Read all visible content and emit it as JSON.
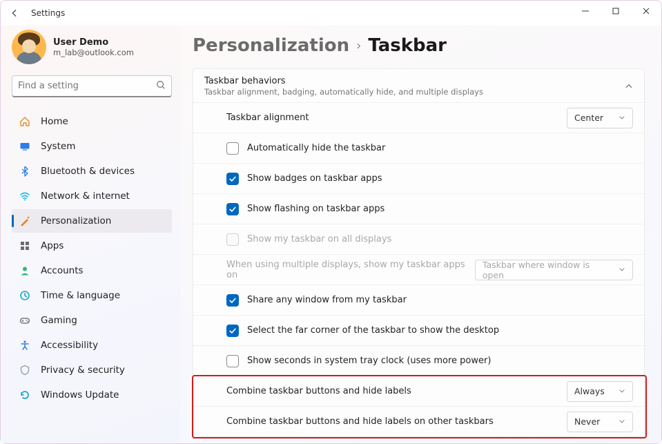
{
  "titlebar": {
    "title": "Settings"
  },
  "user": {
    "name": "User Demo",
    "email": "m_lab@outlook.com"
  },
  "search": {
    "placeholder": "Find a setting"
  },
  "nav": [
    {
      "id": "home",
      "label": "Home",
      "icon": "home",
      "color": "#e38b29"
    },
    {
      "id": "system",
      "label": "System",
      "icon": "system",
      "color": "#2b7de9"
    },
    {
      "id": "bluetooth",
      "label": "Bluetooth & devices",
      "icon": "bluetooth",
      "color": "#2b7de9"
    },
    {
      "id": "network",
      "label": "Network & internet",
      "icon": "network",
      "color": "#17c0eb"
    },
    {
      "id": "personalization",
      "label": "Personalization",
      "icon": "personalization",
      "color": "#e38b29",
      "active": true
    },
    {
      "id": "apps",
      "label": "Apps",
      "icon": "apps",
      "color": "#6b6b6b"
    },
    {
      "id": "accounts",
      "label": "Accounts",
      "icon": "accounts",
      "color": "#2eb872"
    },
    {
      "id": "time",
      "label": "Time & language",
      "icon": "time",
      "color": "#1aaac7"
    },
    {
      "id": "gaming",
      "label": "Gaming",
      "icon": "gaming",
      "color": "#7a7a7a"
    },
    {
      "id": "accessibility",
      "label": "Accessibility",
      "icon": "accessibility",
      "color": "#3b7dd8"
    },
    {
      "id": "privacy",
      "label": "Privacy & security",
      "icon": "privacy",
      "color": "#9ba4ad"
    },
    {
      "id": "update",
      "label": "Windows Update",
      "icon": "update",
      "color": "#1aaac7"
    }
  ],
  "breadcrumb": {
    "parent": "Personalization",
    "current": "Taskbar"
  },
  "panel": {
    "title": "Taskbar behaviors",
    "subtitle": "Taskbar alignment, badging, automatically hide, and multiple displays",
    "rows": [
      {
        "kind": "dropdown",
        "label": "Taskbar alignment",
        "value": "Center"
      },
      {
        "kind": "check",
        "label": "Automatically hide the taskbar",
        "checked": false
      },
      {
        "kind": "check",
        "label": "Show badges on taskbar apps",
        "checked": true
      },
      {
        "kind": "check",
        "label": "Show flashing on taskbar apps",
        "checked": true
      },
      {
        "kind": "check",
        "label": "Show my taskbar on all displays",
        "checked": false,
        "disabled": true
      },
      {
        "kind": "dropdown",
        "label": "When using multiple displays, show my taskbar apps on",
        "value": "Taskbar where window is open",
        "disabled": true,
        "wide": true
      },
      {
        "kind": "check",
        "label": "Share any window from my taskbar",
        "checked": true
      },
      {
        "kind": "check",
        "label": "Select the far corner of the taskbar to show the desktop",
        "checked": true
      },
      {
        "kind": "check",
        "label": "Show seconds in system tray clock (uses more power)",
        "checked": false
      },
      {
        "kind": "dropdown",
        "label": "Combine taskbar buttons and hide labels",
        "value": "Always"
      },
      {
        "kind": "dropdown",
        "label": "Combine taskbar buttons and hide labels on other taskbars",
        "value": "Never"
      }
    ]
  }
}
